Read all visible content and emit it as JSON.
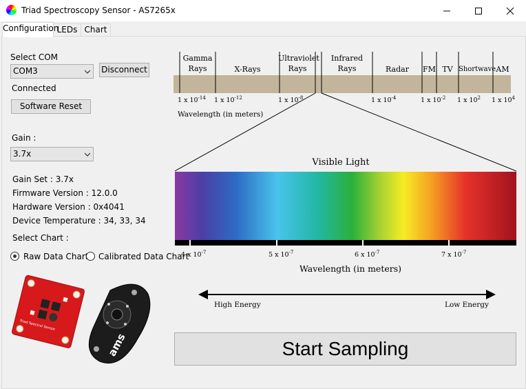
{
  "window": {
    "title": "Triad Spectroscopy Sensor - AS7265x",
    "minimize_symbol": "—",
    "maximize_symbol": "☐",
    "close_symbol": "✕"
  },
  "tabs": [
    {
      "label": "Configuration",
      "active": true
    },
    {
      "label": "LEDs",
      "active": false
    },
    {
      "label": "Chart",
      "active": false
    }
  ],
  "config": {
    "select_com_label": "Select COM",
    "com_value": "COM3",
    "disconnect_label": "Disconnect",
    "status": "Connected",
    "software_reset_label": "Software Reset",
    "gain_label": "Gain :",
    "gain_value": "3.7x",
    "gain_set": "Gain Set : 3.7x",
    "firmware": "Firmware Version : 12.0.0",
    "hardware": "Hardware Version : 0x4041",
    "temperature": "Device Temperature : 34, 33, 34",
    "select_chart_label": "Select Chart :",
    "radio_raw": "Raw Data Chart",
    "radio_calibrated": "Calibrated Data Chart",
    "selected_chart": "raw"
  },
  "spectrum": {
    "bands": [
      {
        "line1": "Gamma",
        "line2": "Rays"
      },
      {
        "line1": "X-Rays",
        "line2": ""
      },
      {
        "line1": "Ultraviolet",
        "line2": "Rays"
      },
      {
        "line1": "Infrared",
        "line2": "Rays"
      },
      {
        "line1": "Radar",
        "line2": ""
      },
      {
        "line1": "FM",
        "line2": ""
      },
      {
        "line1": "TV",
        "line2": ""
      },
      {
        "line1": "Shortwave",
        "line2": ""
      },
      {
        "line1": "AM",
        "line2": ""
      }
    ],
    "ticks": [
      {
        "base": "1 x 10",
        "exp": "-14"
      },
      {
        "base": "1 x 10",
        "exp": "-12"
      },
      {
        "base": "1 x 10",
        "exp": "-8"
      },
      {
        "base": "1 x 10",
        "exp": "-4"
      },
      {
        "base": "1 x 10",
        "exp": "-2"
      },
      {
        "base": "1 x 10",
        "exp": "2"
      },
      {
        "base": "1 x 10",
        "exp": "4"
      }
    ],
    "wavelength_label": "Wavelength (in meters)",
    "visible_title": "Visible Light",
    "visible_ticks": [
      {
        "base": "4 x 10",
        "exp": "-7"
      },
      {
        "base": "5 x 10",
        "exp": "-7"
      },
      {
        "base": "6 x 10",
        "exp": "-7"
      },
      {
        "base": "7 x 10",
        "exp": "-7"
      }
    ],
    "visible_wavelength_label": "Wavelength (in meters)",
    "high_energy": "High Energy",
    "low_energy": "Low Energy"
  },
  "start_sampling_label": "Start Sampling",
  "board_images": {
    "red_board_text": "Triad Spectral Sensor",
    "black_board_brand": "ams"
  }
}
